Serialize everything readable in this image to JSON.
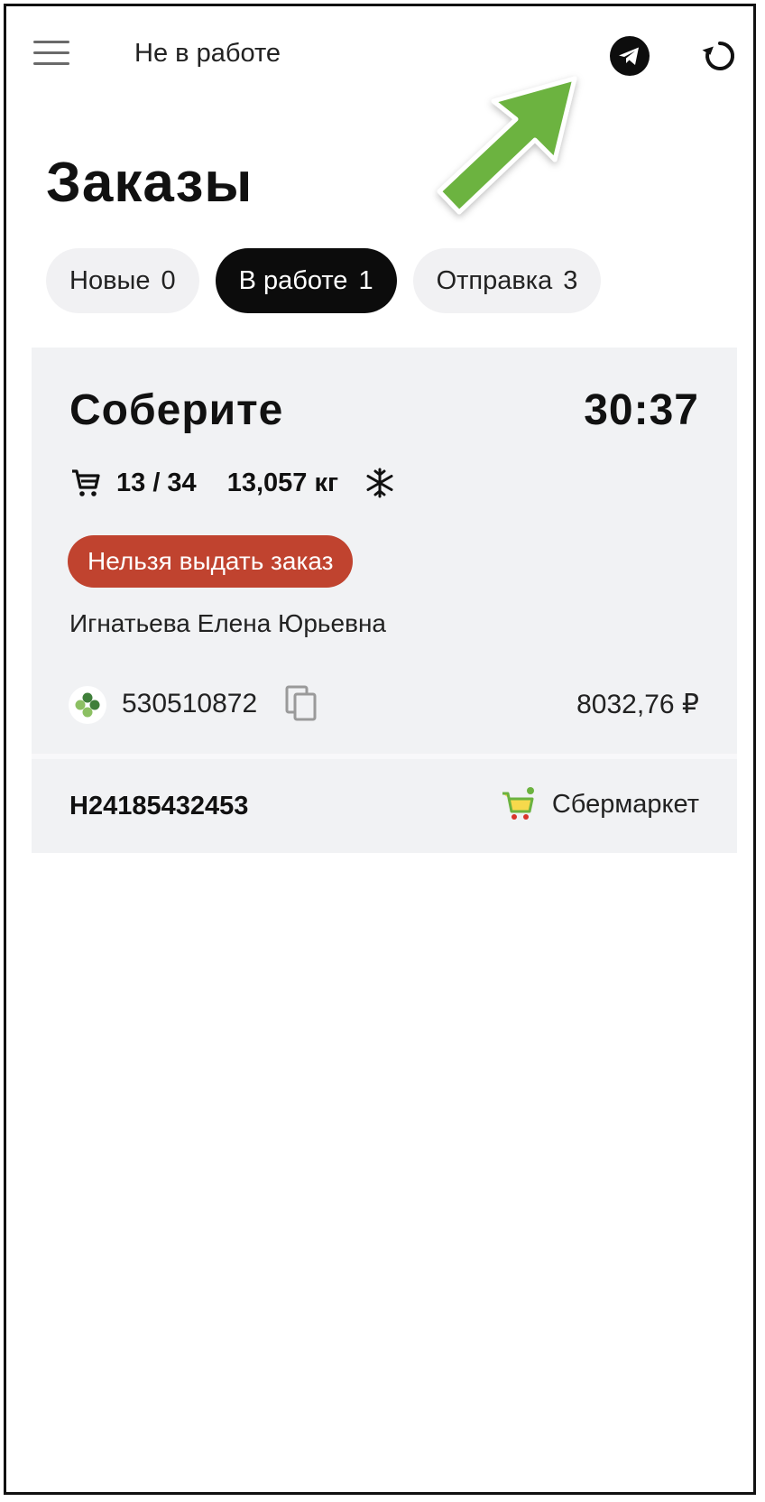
{
  "header": {
    "status_label": "Не в работе",
    "icons": {
      "menu": "hamburger-menu-icon",
      "telegram": "telegram-icon",
      "refresh": "refresh-icon"
    }
  },
  "page": {
    "title": "Заказы"
  },
  "tabs": [
    {
      "label": "Новые",
      "count": "0",
      "active": false
    },
    {
      "label": "В работе",
      "count": "1",
      "active": true
    },
    {
      "label": "Отправка",
      "count": "3",
      "active": false
    }
  ],
  "order": {
    "status": "Соберите",
    "timer": "30:37",
    "items": "13 / 34",
    "weight": "13,057 кг",
    "warning": "Нельзя выдать заказ",
    "customer_name": "Игнатьева Елена  Юрьевна",
    "order_number": "530510872",
    "price": "8032,76 ₽",
    "shipment_id": "H24185432453",
    "store_name": "Сбермаркет"
  },
  "colors": {
    "accent_dark": "#0c0c0c",
    "tab_bg": "#f1f1f3",
    "card_bg": "#f1f2f4",
    "warning_bg": "#c0432f",
    "arrow_green": "#6cb33f"
  }
}
